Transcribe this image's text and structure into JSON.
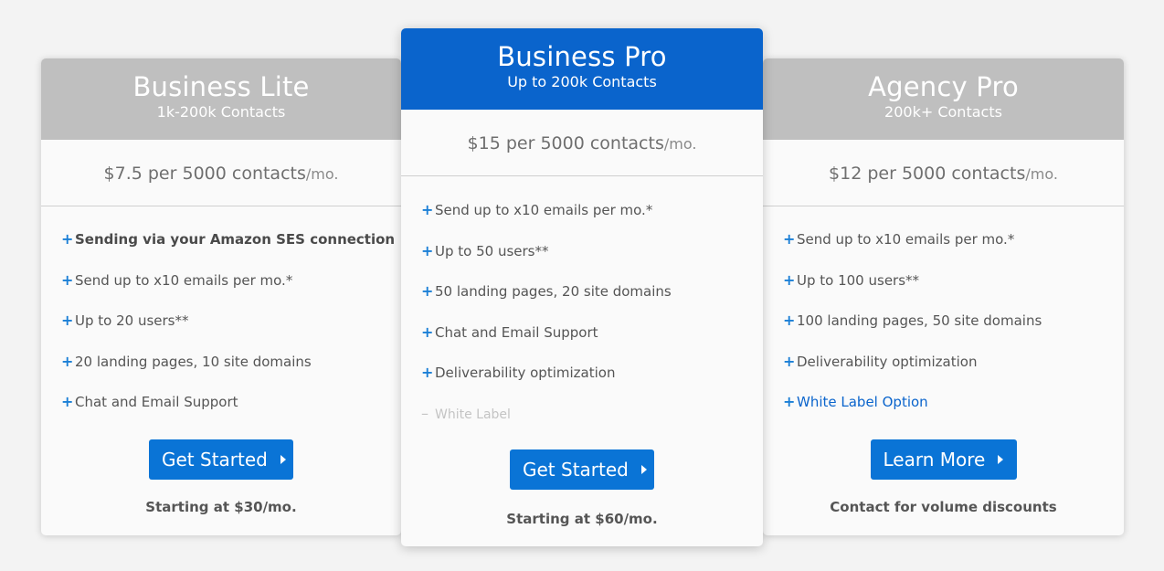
{
  "plans": [
    {
      "title": "Business Lite",
      "subtitle": "1k-200k Contacts",
      "price": "$7.5 per 5000 contacts",
      "price_unit": "/mo.",
      "features": [
        "Sending via your Amazon SES connection",
        "Send up to x10 emails per mo.*",
        "Up to 20 users**",
        "20 landing pages, 10 site domains",
        "Chat and Email Support"
      ],
      "button_label": "Get Started",
      "footer": "Starting at $30/mo."
    },
    {
      "title": "Business Pro",
      "subtitle": "Up to 200k Contacts",
      "price": "$15 per 5000 contacts",
      "price_unit": "/mo.",
      "features": [
        "Send up to x10 emails per mo.*",
        "Up to 50 users**",
        "50 landing pages, 20 site domains",
        "Chat and Email Support",
        "Deliverability optimization"
      ],
      "unavailable_feature": "White Label",
      "button_label": "Get Started",
      "footer": "Starting at $60/mo."
    },
    {
      "title": "Agency Pro",
      "subtitle": "200k+ Contacts",
      "price": "$12 per 5000 contacts",
      "price_unit": "/mo.",
      "features": [
        "Send up to x10 emails per mo.*",
        "Up to 100 users**",
        "100 landing pages, 50 site domains",
        "Deliverability optimization"
      ],
      "link_feature": "White Label Option",
      "button_label": "Learn More",
      "footer": "Contact for volume discounts"
    }
  ],
  "symbols": {
    "plus": "+",
    "minus": "–"
  },
  "colors": {
    "accent_blue": "#0a64cc",
    "button_blue": "#0a74d6",
    "header_gray": "#bfbfbf",
    "plus_blue": "#1b7fd6"
  }
}
